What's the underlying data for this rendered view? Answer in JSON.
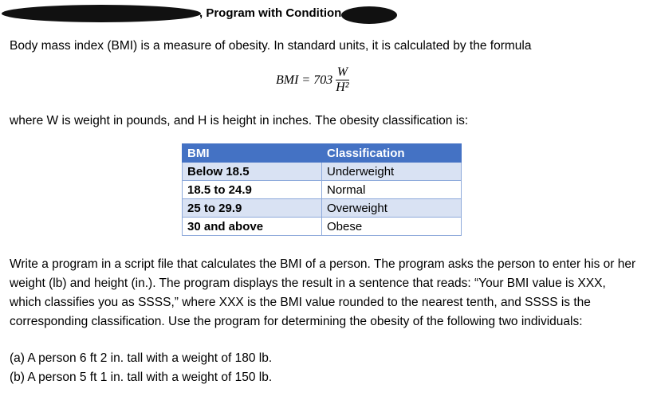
{
  "header": {
    "title": ", Program with Condition"
  },
  "intro": "Body mass index (BMI) is a measure of obesity. In standard units, it is calculated by the formula",
  "formula": {
    "lhs": "BMI = 703",
    "numerator": "W",
    "denominator": "H²"
  },
  "where": "where W is weight in pounds, and H is height in inches. The obesity classification is:",
  "table": {
    "headers": [
      "BMI",
      "Classification"
    ],
    "rows": [
      [
        "Below 18.5",
        "Underweight"
      ],
      [
        "18.5 to 24.9",
        "Normal"
      ],
      [
        "25 to 29.9",
        "Overweight"
      ],
      [
        "30 and above",
        "Obese"
      ]
    ]
  },
  "problem": "Write a program in a script file that calculates the BMI of a person. The program asks the person to enter his or her weight (lb) and height (in.). The program displays the result in a sentence that reads: “Your BMI value is XXX, which classifies you as SSSS,” where XXX is the BMI value rounded to the nearest tenth, and SSSS is the corresponding classification. Use the program for determining the obesity of the following two individuals:",
  "cases": [
    "(a) A person 6 ft 2 in. tall with a weight of 180 lb.",
    "(b) A person 5 ft 1 in. tall with a weight of 150 lb."
  ]
}
